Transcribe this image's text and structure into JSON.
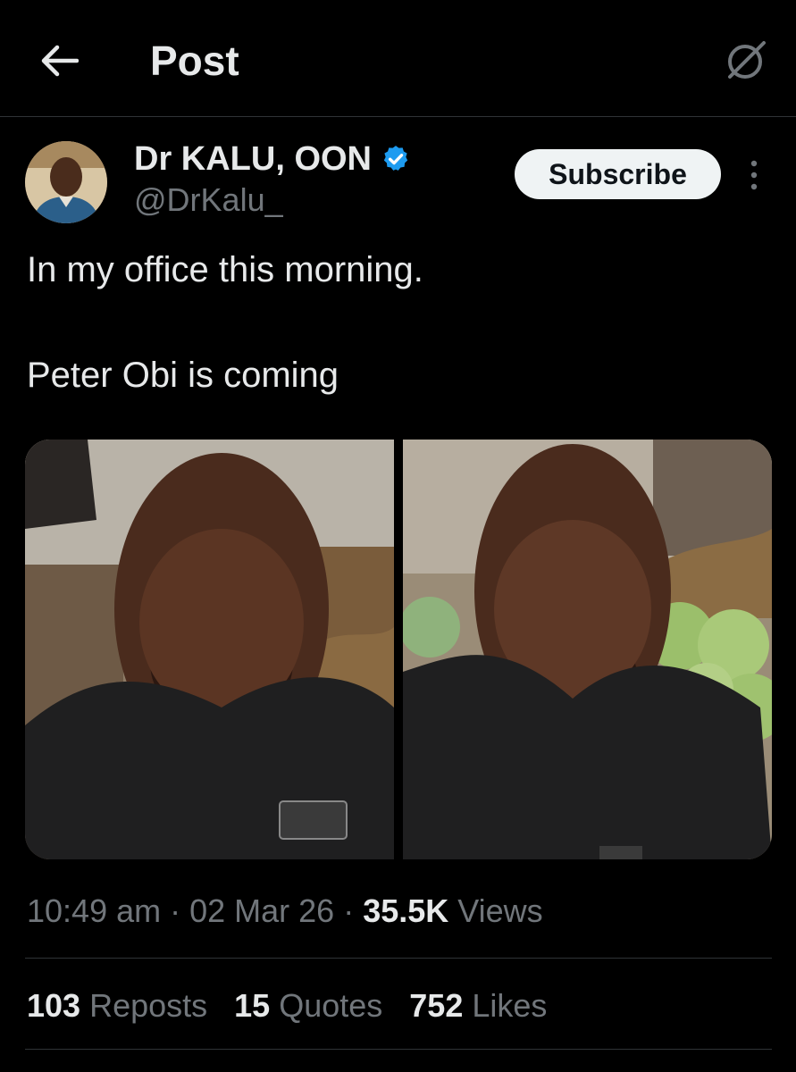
{
  "header": {
    "title": "Post",
    "back_icon": "arrow-left-icon",
    "grok_icon": "slashed-circle-icon"
  },
  "author": {
    "name": "Dr KALU, OON",
    "handle": "@DrKalu_",
    "verified_color": "#1d9bf0",
    "subscribe_label": "Subscribe",
    "more_icon": "vertical-ellipsis-icon"
  },
  "post": {
    "line1": "In my office this morning.",
    "line2": "Peter Obi is coming"
  },
  "meta": {
    "time": "10:49 am",
    "sep1": " · ",
    "date": "02 Mar 26",
    "sep2": " · ",
    "views_count": "35.5K",
    "views_label": " Views"
  },
  "stats": {
    "reposts_count": "103",
    "reposts_label": " Reposts",
    "quotes_count": "15",
    "quotes_label": " Quotes",
    "likes_count": "752",
    "likes_label": " Likes"
  },
  "colors": {
    "background": "#000000",
    "text_primary": "#e7e9ea",
    "text_secondary": "#71767b",
    "divider": "#2f3336",
    "accent": "#1d9bf0"
  }
}
